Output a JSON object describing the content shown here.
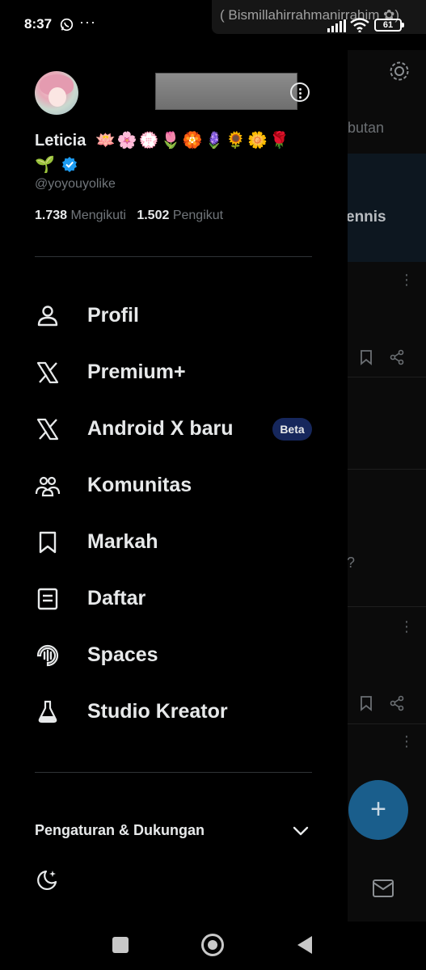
{
  "status_bar": {
    "time": "8:37",
    "overflow": "···",
    "banner_text": "( Bismillahirrahmanirrahim ✿)",
    "battery": "61",
    "icons": [
      "whatsapp-icon",
      "signal-icon",
      "wifi-icon",
      "battery-icon"
    ]
  },
  "profile": {
    "display_name": "Leticia",
    "name_emojis": "🪷🌸💮🌷🏵️🪻🌻🌼🌹",
    "name_emoji_line2": "🌱",
    "handle": "@yoyouyolike",
    "following_count": "1.738",
    "following_label": "Mengikuti",
    "followers_count": "1.502",
    "followers_label": "Pengikut"
  },
  "menu": [
    {
      "label": "Profil",
      "icon": "person-icon"
    },
    {
      "label": "Premium+",
      "icon": "x-logo-icon"
    },
    {
      "label": "Android X baru",
      "icon": "x-logo-icon",
      "badge": "Beta"
    },
    {
      "label": "Komunitas",
      "icon": "communities-icon"
    },
    {
      "label": "Markah",
      "icon": "bookmark-icon"
    },
    {
      "label": "Daftar",
      "icon": "list-icon"
    },
    {
      "label": "Spaces",
      "icon": "spaces-icon"
    },
    {
      "label": "Studio Kreator",
      "icon": "flask-icon"
    }
  ],
  "settings": {
    "label": "Pengaturan & Dukungan"
  },
  "background": {
    "tab_fragment": "butan",
    "card_fragment": "ennis",
    "question_fragment": "?",
    "fab_symbol": "+"
  },
  "colors": {
    "accent": "#1d9bf0",
    "beta_badge": "#16275c",
    "muted_text": "#71767b"
  }
}
